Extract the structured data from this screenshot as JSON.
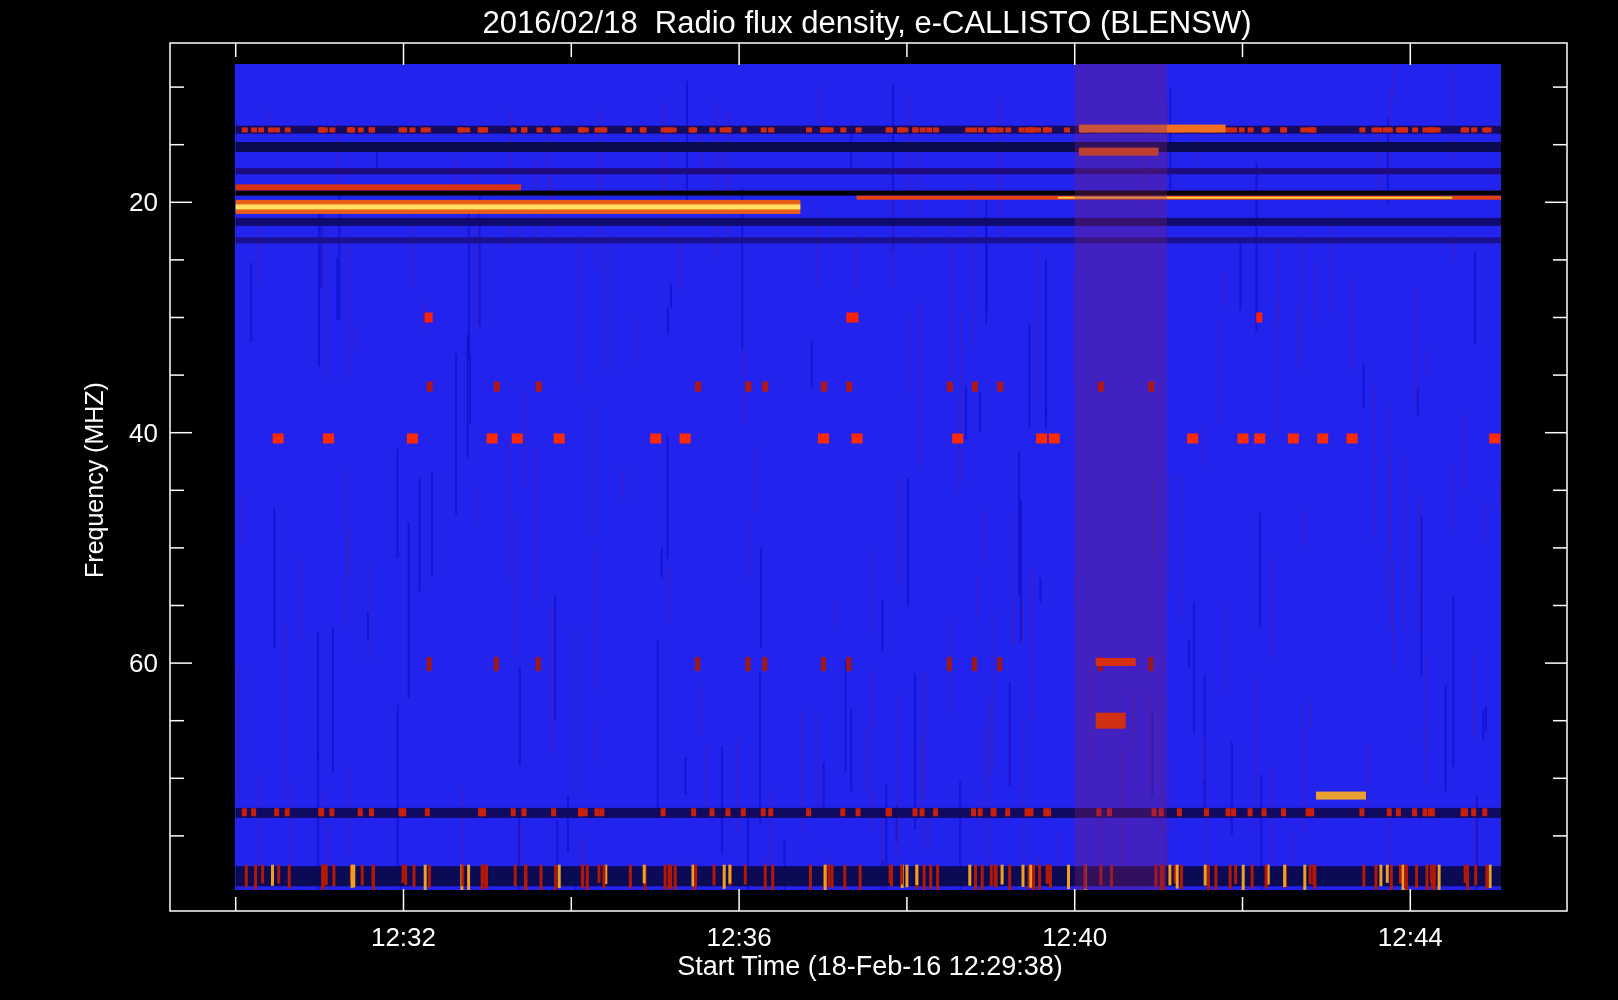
{
  "plot": {
    "title": "2016/02/18  Radio flux density, e-CALLISTO (BLENSW)",
    "ylabel": "Frequency (MHZ)",
    "xlabel": "Start Time (18-Feb-16 12:29:38)",
    "y_tick_labels": [
      "20",
      "40",
      "60"
    ],
    "x_tick_labels": [
      "12:32",
      "12:36",
      "12:40",
      "12:44"
    ]
  }
}
